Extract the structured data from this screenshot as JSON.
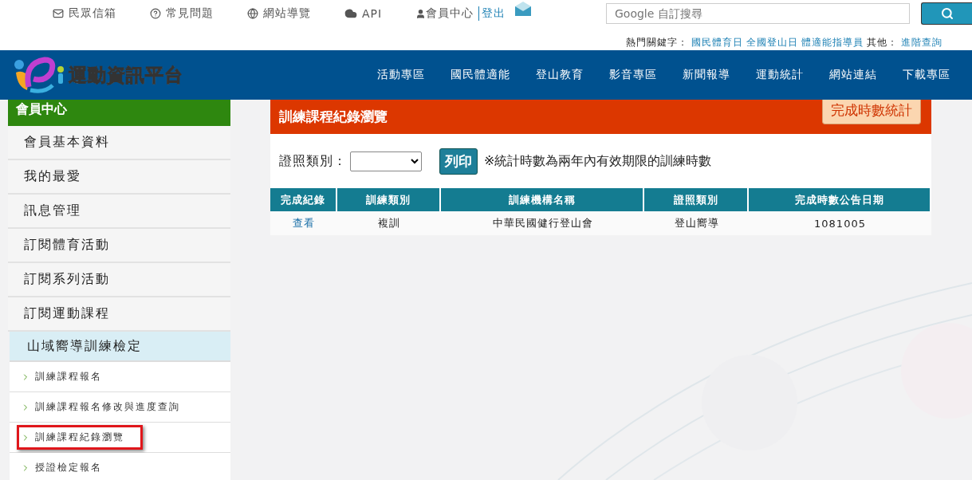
{
  "top_links": [
    {
      "kind": "mail",
      "label": "民眾信箱"
    },
    {
      "kind": "help",
      "label": "常見問題"
    },
    {
      "kind": "globe",
      "label": "網站導覽"
    },
    {
      "kind": "cloud",
      "label": "API"
    }
  ],
  "member": {
    "label": "會員中心",
    "logout": "登出"
  },
  "search": {
    "placeholder": "Google 自訂搜尋"
  },
  "hot_keywords": {
    "label": "熱門關鍵字：",
    "links": [
      "國民體育日",
      "全國登山日",
      "體適能指導員"
    ],
    "other_label": "其他：",
    "other_link": "進階查詢"
  },
  "site_name": "運動資訊平台",
  "nav": [
    "活動專區",
    "國民體適能",
    "登山教育",
    "影音專區",
    "新聞報導",
    "運動統計",
    "網站連結",
    "下載專區"
  ],
  "sidebar": {
    "title": "會員中心",
    "items": [
      "會員基本資料",
      "我的最愛",
      "訊息管理",
      "訂閱體育活動",
      "訂閱系列活動",
      "訂閱運動課程"
    ],
    "section": "山域嚮導訓練檢定",
    "sub_items": [
      {
        "label": "訓練課程報名",
        "selected": false
      },
      {
        "label": "訓練課程報名修改與進度查詢",
        "selected": false
      },
      {
        "label": "訓練課程紀錄瀏覽",
        "selected": true
      },
      {
        "label": "授證檢定報名",
        "selected": false
      }
    ]
  },
  "panel": {
    "title": "訓練課程紀錄瀏覽",
    "stats_button": "完成時數統計",
    "filter_label": "證照類別：",
    "print_button": "列印",
    "note": "※統計時數為兩年內有效期限的訓練時數"
  },
  "table": {
    "columns": [
      "完成紀錄",
      "訓練類別",
      "訓練機構名稱",
      "證照類別",
      "完成時數公告日期"
    ],
    "rows": [
      {
        "cells": [
          "查看",
          "複訓",
          "中華民國健行登山會",
          "登山嚮導",
          "1081005"
        ]
      }
    ]
  }
}
